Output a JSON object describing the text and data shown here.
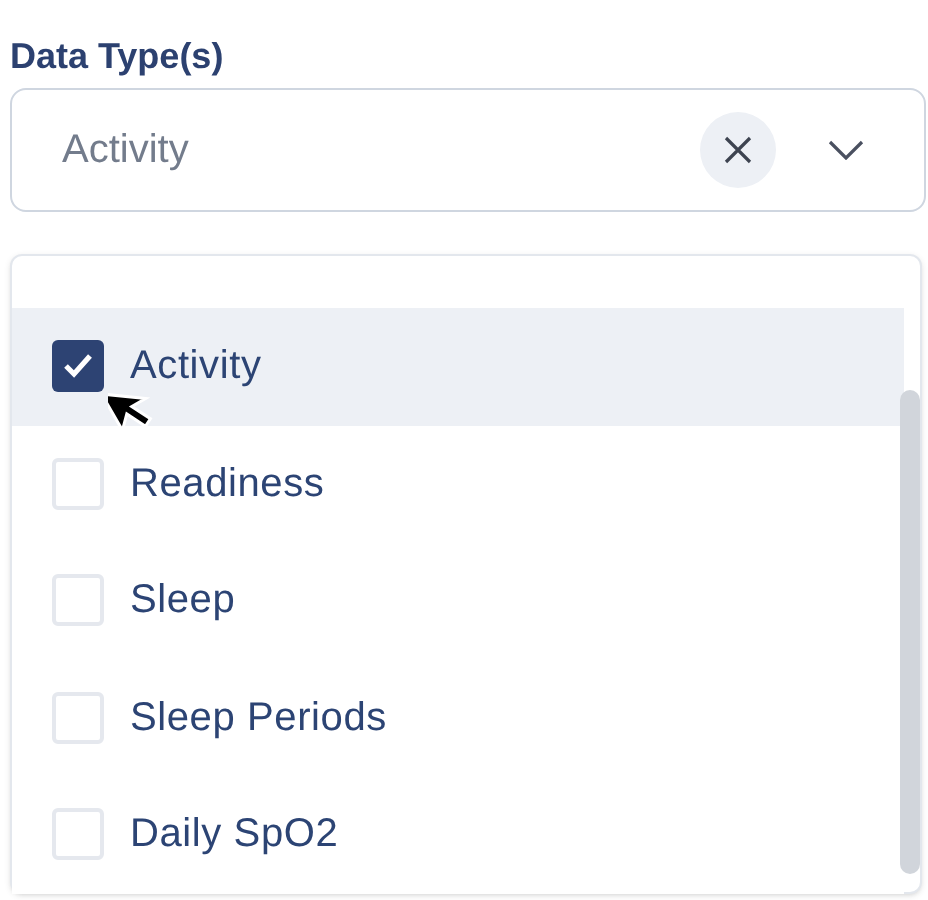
{
  "field": {
    "label": "Data Type(s)",
    "value": "Activity"
  },
  "options": [
    {
      "label": "Activity",
      "checked": true,
      "selected": true
    },
    {
      "label": "Readiness",
      "checked": false,
      "selected": false
    },
    {
      "label": "Sleep",
      "checked": false,
      "selected": false
    },
    {
      "label": "Sleep Periods",
      "checked": false,
      "selected": false
    },
    {
      "label": "Daily SpO2",
      "checked": false,
      "selected": false
    }
  ]
}
